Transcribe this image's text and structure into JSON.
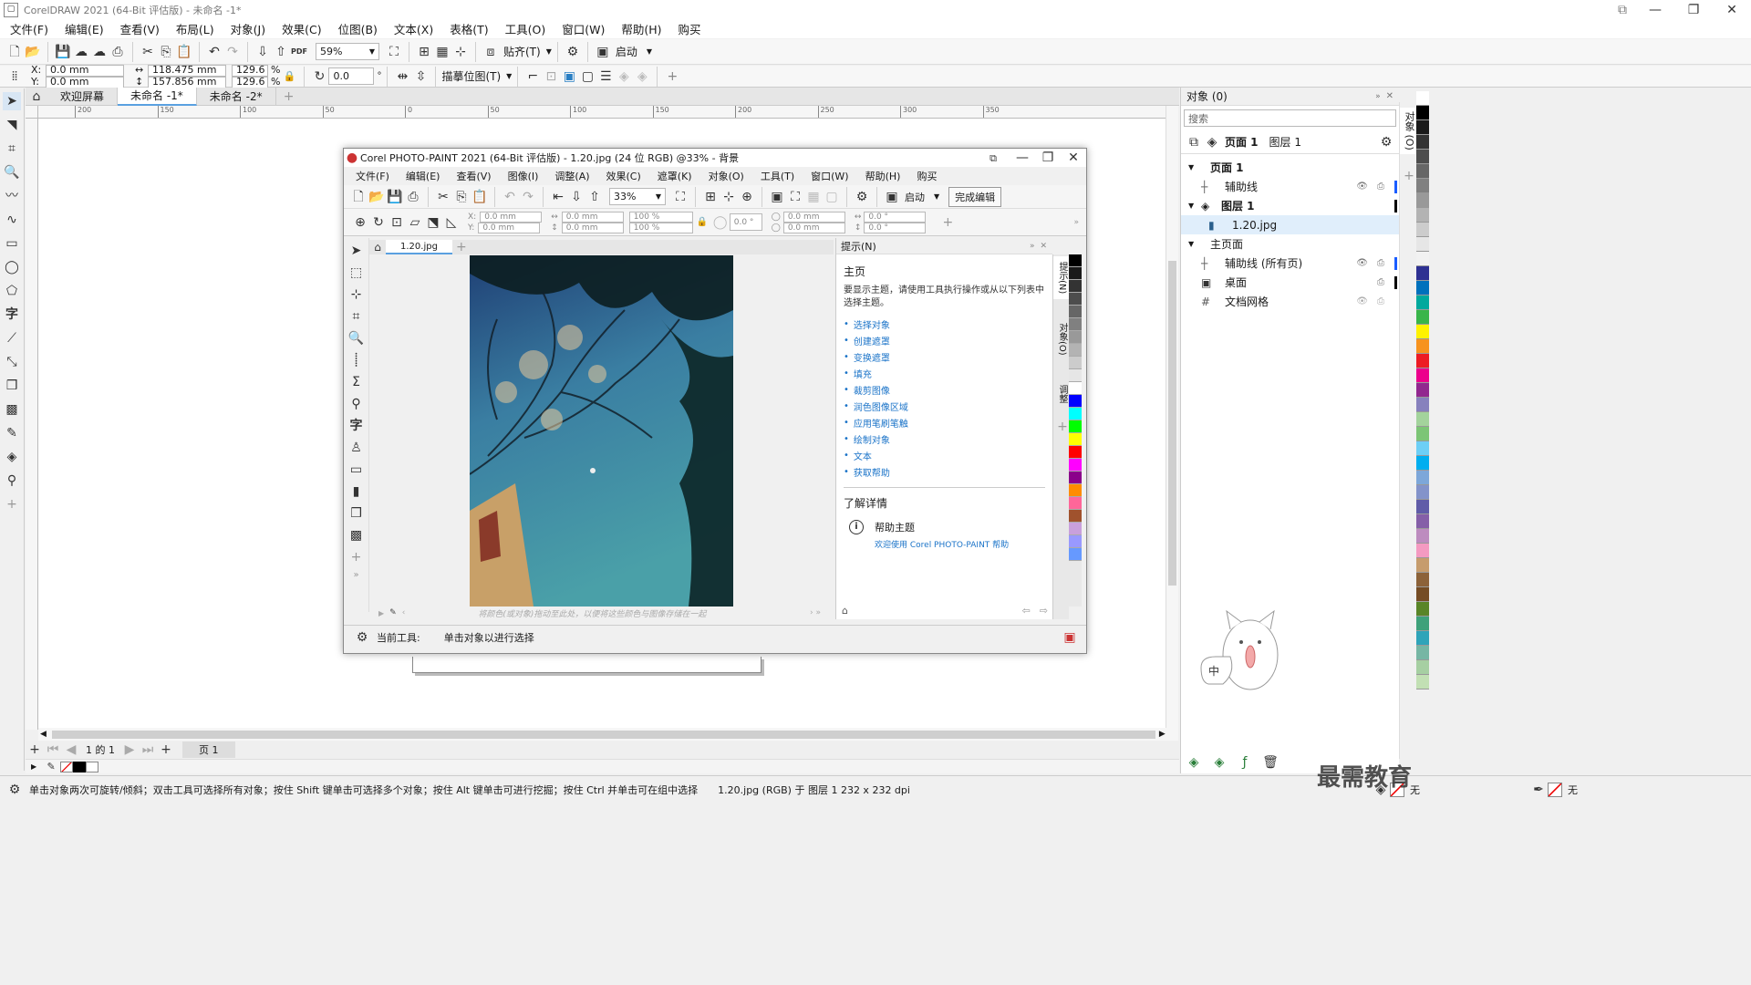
{
  "window": {
    "title": "CorelDRAW 2021 (64-Bit 评估版) - 未命名 -1*"
  },
  "menu": [
    "文件(F)",
    "编辑(E)",
    "查看(V)",
    "布局(L)",
    "对象(J)",
    "效果(C)",
    "位图(B)",
    "文本(X)",
    "表格(T)",
    "工具(O)",
    "窗口(W)",
    "帮助(H)",
    "购买"
  ],
  "toolbar": {
    "zoom": "59%",
    "snap": "贴齐(T)",
    "launch": "启动"
  },
  "props": {
    "x": "0.0 mm",
    "y": "0.0 mm",
    "w": "118.475 mm",
    "h": "157.856 mm",
    "sx": "129.6",
    "sy": "129.6",
    "pct": "%",
    "angle": "0.0",
    "trace": "描摹位图(T)"
  },
  "doc_tabs": [
    "欢迎屏幕",
    "未命名 -1*",
    "未命名 -2*"
  ],
  "ruler_h": [
    "200",
    "150",
    "100",
    "50",
    "0",
    "50",
    "100",
    "150",
    "200",
    "250",
    "300",
    "350"
  ],
  "page_nav": {
    "pages": "1 的 1",
    "page_tab": "页 1"
  },
  "status": {
    "hint": "单击对象两次可旋转/倾斜；双击工具可选择所有对象；按住 Shift 键单击可选择多个对象；按住 Alt 键单击可进行挖掘；按住 Ctrl 并单击可在组中选择",
    "info": "1.20.jpg (RGB) 于 图层 1 232 x 232 dpi",
    "fill_none": "无",
    "outline_none": "无"
  },
  "objects_panel": {
    "title": "对象 (0)",
    "search_placeholder": "搜索",
    "page_label": "页面 1",
    "layer_label": "图层 1",
    "tree": {
      "page1": "页面 1",
      "guides": "辅助线",
      "layer1": "图层 1",
      "image": "1.20.jpg",
      "master": "主页面",
      "guides_all": "辅助线 (所有页)",
      "desktop": "桌面",
      "grid": "文档网格"
    },
    "side_tabs": [
      "对象 (O)"
    ]
  },
  "photopaint": {
    "title": "Corel PHOTO-PAINT 2021 (64-Bit 评估版) - 1.20.jpg (24 位 RGB) @33% - 背景",
    "menu": [
      "文件(F)",
      "编辑(E)",
      "查看(V)",
      "图像(I)",
      "调整(A)",
      "效果(C)",
      "遮罩(K)",
      "对象(O)",
      "工具(T)",
      "窗口(W)",
      "帮助(H)",
      "购买"
    ],
    "zoom": "33%",
    "launch": "启动",
    "finish": "完成编辑",
    "props": {
      "x": "0.0 mm",
      "y": "0.0 mm",
      "w": "0.0 mm",
      "h": "0.0 mm",
      "sx": "100 %",
      "sy": "100 %",
      "rot": "0.0 °",
      "px": "0.0 mm",
      "py": "0.0 mm",
      "sk1": "0.0 °",
      "sk2": "0.0 °"
    },
    "tab": "1.20.jpg",
    "colorbar_hint": "将颜色(或对象)拖动至此处，以便将这些颜色与图像存储在一起",
    "status_label": "当前工具:",
    "status_text": "单击对象以进行选择",
    "hints": {
      "header": "提示(N)",
      "title": "主页",
      "desc": "要显示主题，请使用工具执行操作或从以下列表中选择主题。",
      "links": [
        "选择对象",
        "创建遮罩",
        "变换遮罩",
        "填充",
        "裁剪图像",
        "润色图像区域",
        "应用笔刷笔触",
        "绘制对象",
        "文本",
        "获取帮助"
      ],
      "learn": "了解详情",
      "help_title": "帮助主题",
      "help_link": "欢迎使用 Corel PHOTO-PAINT 帮助"
    },
    "side_tabs": [
      "提示(N)",
      "对象(O)",
      "调整"
    ]
  },
  "watermark": "最需教育",
  "mascot_text": "中"
}
